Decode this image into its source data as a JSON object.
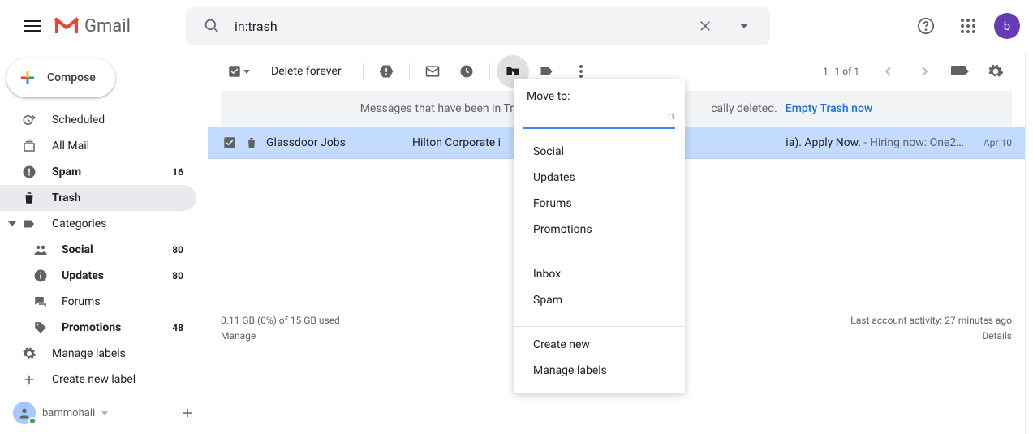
{
  "header": {
    "app_name": "Gmail",
    "search_value": "in:trash",
    "avatar_letter": "b"
  },
  "compose_label": "Compose",
  "sidebar": {
    "items": [
      {
        "icon": "clock-send",
        "label": "Scheduled",
        "count": "",
        "bold": false,
        "active": false,
        "indent": false
      },
      {
        "icon": "stack",
        "label": "All Mail",
        "count": "",
        "bold": false,
        "active": false,
        "indent": false
      },
      {
        "icon": "alert",
        "label": "Spam",
        "count": "16",
        "bold": true,
        "active": false,
        "indent": false
      },
      {
        "icon": "trash",
        "label": "Trash",
        "count": "",
        "bold": true,
        "active": true,
        "indent": false
      },
      {
        "icon": "tag",
        "label": "Categories",
        "count": "",
        "bold": false,
        "active": false,
        "indent": false,
        "categories_row": true
      },
      {
        "icon": "people",
        "label": "Social",
        "count": "80",
        "bold": true,
        "active": false,
        "indent": true
      },
      {
        "icon": "info",
        "label": "Updates",
        "count": "80",
        "bold": true,
        "active": false,
        "indent": true
      },
      {
        "icon": "forum",
        "label": "Forums",
        "count": "",
        "bold": false,
        "active": false,
        "indent": true
      },
      {
        "icon": "local-offer",
        "label": "Promotions",
        "count": "48",
        "bold": true,
        "active": false,
        "indent": true
      },
      {
        "icon": "gear",
        "label": "Manage labels",
        "count": "",
        "bold": false,
        "active": false,
        "indent": false
      },
      {
        "icon": "plus",
        "label": "Create new label",
        "count": "",
        "bold": false,
        "active": false,
        "indent": false
      }
    ]
  },
  "chat": {
    "user_name": "bammohali"
  },
  "toolbar": {
    "delete_forever": "Delete forever",
    "page_count": "1–1 of 1"
  },
  "banner": {
    "text_left": "Messages that have been in Trash m",
    "text_right": "cally deleted.",
    "link": "Empty Trash now"
  },
  "email_row": {
    "sender": "Glassdoor Jobs",
    "subject_left": "Hilton Corporate i",
    "subject_right": "ia). Apply Now.",
    "snippet": " - Hiring now: One2One…",
    "date": "Apr 10"
  },
  "footer": {
    "storage_line": "0.11 GB (0%) of 15 GB used",
    "manage": "Manage",
    "activity_line": "Last account activity: 27 minutes ago",
    "details": "Details"
  },
  "moveto": {
    "title": "Move to:",
    "groups": [
      [
        "Social",
        "Updates",
        "Forums",
        "Promotions"
      ],
      [
        "Inbox",
        "Spam"
      ],
      [
        "Create new",
        "Manage labels"
      ]
    ]
  }
}
